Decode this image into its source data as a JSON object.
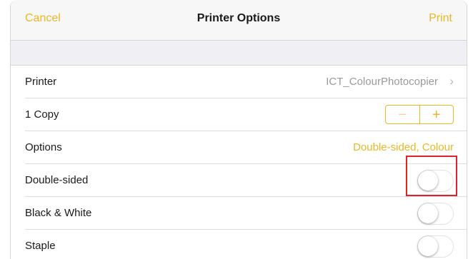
{
  "navbar": {
    "cancel_label": "Cancel",
    "title": "Printer Options",
    "print_label": "Print"
  },
  "rows": {
    "printer": {
      "label": "Printer",
      "value": "ICT_ColourPhotocopier",
      "chevron": "›"
    },
    "copies": {
      "label": "1 Copy",
      "minus": "−",
      "plus": "+"
    },
    "options": {
      "label": "Options",
      "value": "Double-sided, Colour"
    },
    "double_sided": {
      "label": "Double-sided",
      "on": false
    },
    "black_white": {
      "label": "Black & White",
      "on": false
    },
    "staple": {
      "label": "Staple",
      "on": false
    }
  },
  "colors": {
    "accent": "#e9b824",
    "highlight": "#e0202a"
  }
}
